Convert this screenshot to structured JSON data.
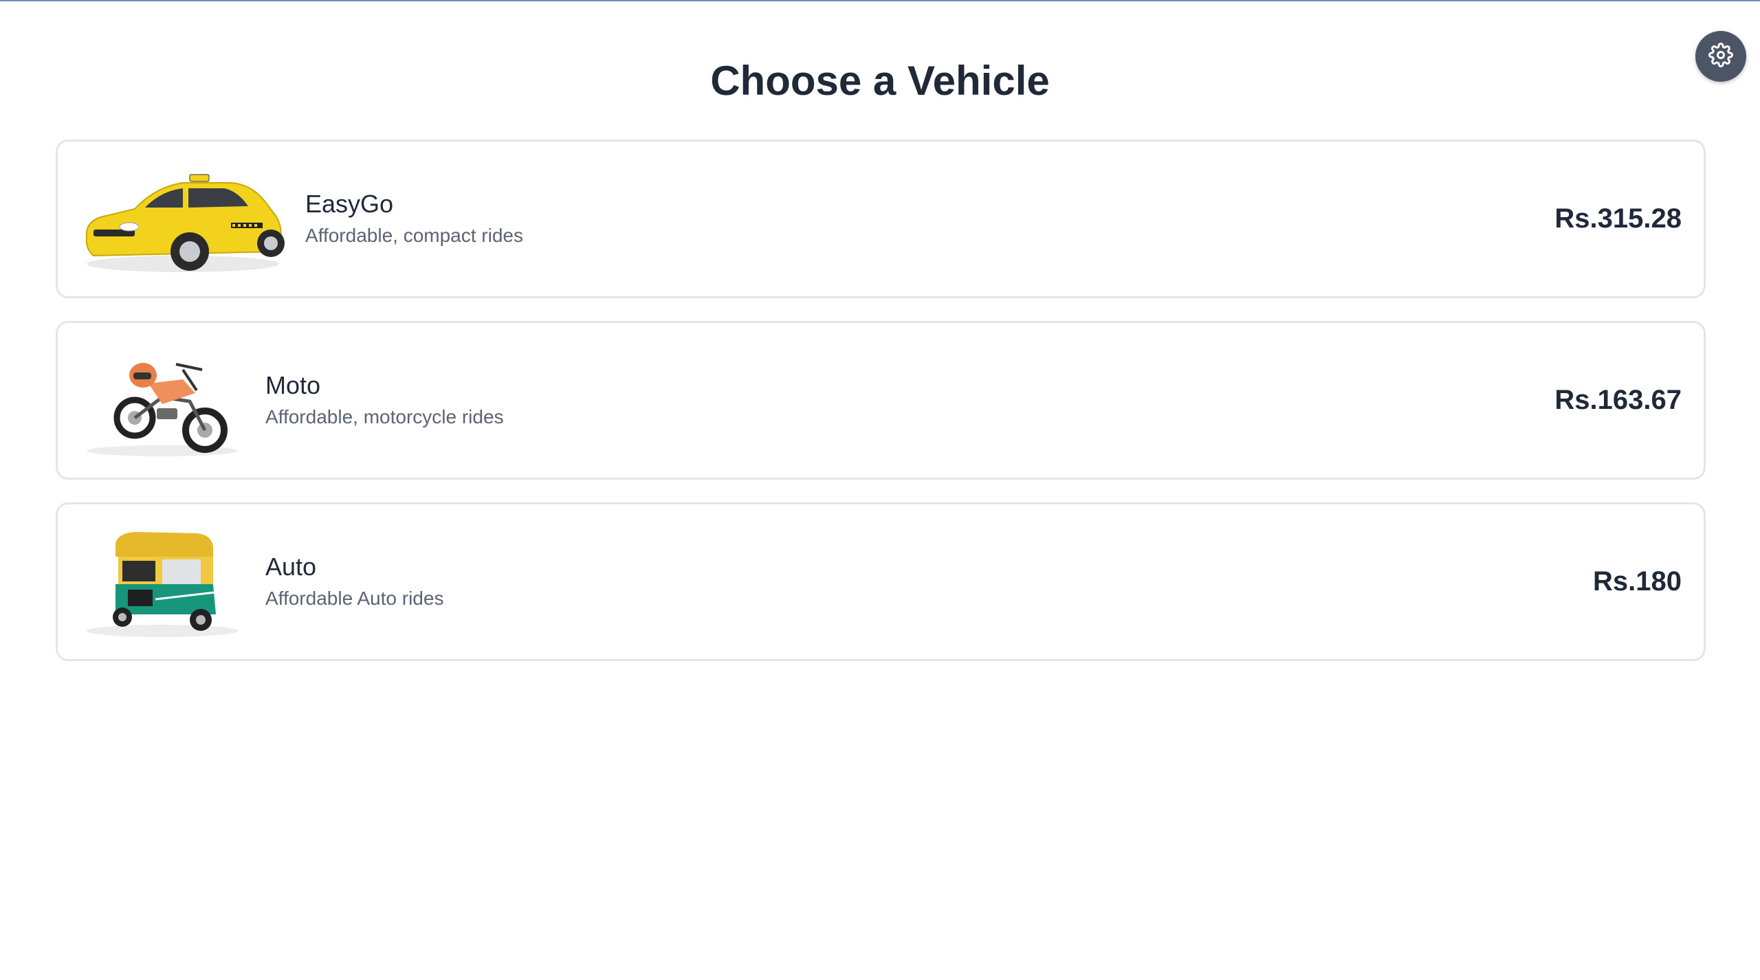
{
  "header": {
    "title": "Choose a Vehicle",
    "settings_icon": "gear-icon"
  },
  "vehicles": [
    {
      "name": "EasyGo",
      "description": "Affordable, compact rides",
      "price": "Rs.315.28",
      "image": "yellow-taxi-car"
    },
    {
      "name": "Moto",
      "description": "Affordable, motorcycle rides",
      "price": "Rs.163.67",
      "image": "orange-motorcycle"
    },
    {
      "name": "Auto",
      "description": "Affordable Auto rides",
      "price": "Rs.180",
      "image": "green-auto-rickshaw"
    }
  ],
  "colors": {
    "accent_line": "#6b8fb5",
    "settings_button": "#4b5565",
    "card_border": "#e2e5ea",
    "title_text": "#1f2937",
    "description_text": "#5b6472"
  }
}
